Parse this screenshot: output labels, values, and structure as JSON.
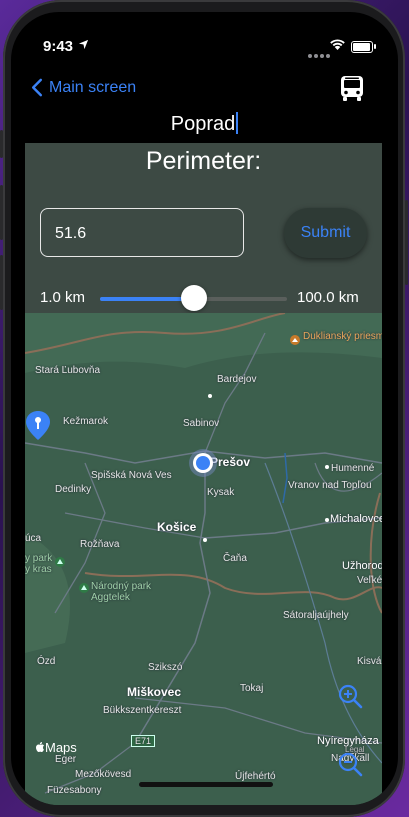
{
  "status": {
    "time": "9:43"
  },
  "nav": {
    "back_label": "Main screen",
    "city": "Poprad"
  },
  "perimeter": {
    "title": "Perimeter:",
    "value": "51.6",
    "submit_label": "Submit",
    "min_label": "1.0 km",
    "max_label": "100.0 km",
    "slider_fraction": 0.5
  },
  "map": {
    "attribution": "Maps",
    "labels": {
      "stara_lubovna": "Stará Ľubovňa",
      "bardejov": "Bardejov",
      "kezmarok": "Kežmarok",
      "sabinov": "Sabinov",
      "presov": "Prešov",
      "spisska": "Spišská Nová Ves",
      "dedinky": "Dedinky",
      "kysak": "Kysak",
      "humenne": "Humenné",
      "vranov": "Vranov nad Topľou",
      "kosice": "Košice",
      "michalovce": "Michalovce",
      "uca": "úca",
      "roznava": "Rožňava",
      "park_left": "y park\ny kras",
      "cana": "Čaňa",
      "uzhorod": "Užhorod",
      "velke": "Veľké",
      "narodny_park": "Národný park\nAggtelek",
      "satoraljaujhely": "Sátoraljaújhely",
      "ozd": "Ózd",
      "szikszo": "Szikszó",
      "kisv": "Kisvá",
      "miskovec": "Miškovec",
      "tokaj": "Tokaj",
      "bukk": "Bükkszentkereszt",
      "e71": "E71",
      "nyiregyhaza": "Nyíregyháza",
      "eger": "Eger",
      "legal": "Legal",
      "nagykallo": "Nagykall",
      "mezokovesd": "Mezőkövesd",
      "ujfeherto": "Újfehértó",
      "fuzesabony": "Füzesabony",
      "dukliansky": "Duklianský\npriesmyk"
    }
  }
}
